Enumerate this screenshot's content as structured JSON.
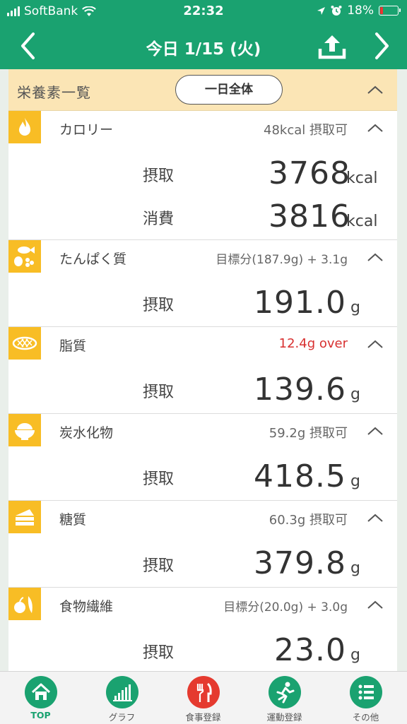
{
  "status_bar": {
    "carrier": "SoftBank",
    "time": "22:32",
    "battery": "18%",
    "battery_level": 0.18
  },
  "header": {
    "title": "今日 1/15 (火)"
  },
  "section": {
    "title": "栄養素一覧",
    "scope_button": "一日全体"
  },
  "nutrients": [
    {
      "name": "カロリー",
      "status": "48kcal 摂取可",
      "rows": [
        {
          "label": "摂取",
          "value": "3768",
          "unit": "kcal"
        },
        {
          "label": "消費",
          "value": "3816",
          "unit": "kcal"
        }
      ]
    },
    {
      "name": "たんぱく質",
      "status": "目標分(187.9g) + 3.1g",
      "rows": [
        {
          "label": "摂取",
          "value": "191.0",
          "unit": "g"
        }
      ]
    },
    {
      "name": "脂質",
      "status": "12.4g over",
      "rows": [
        {
          "label": "摂取",
          "value": "139.6",
          "unit": "g"
        }
      ]
    },
    {
      "name": "炭水化物",
      "status": "59.2g 摂取可",
      "rows": [
        {
          "label": "摂取",
          "value": "418.5",
          "unit": "g"
        }
      ]
    },
    {
      "name": "糖質",
      "status": "60.3g 摂取可",
      "rows": [
        {
          "label": "摂取",
          "value": "379.8",
          "unit": "g"
        }
      ]
    },
    {
      "name": "食物繊維",
      "status": "目標分(20.0g) + 3.0g",
      "rows": [
        {
          "label": "摂取",
          "value": "23.0",
          "unit": "g"
        }
      ]
    }
  ],
  "tabs": [
    {
      "label": "TOP",
      "icon": "home-icon"
    },
    {
      "label": "グラフ",
      "icon": "bar-chart-icon"
    },
    {
      "label": "食事登録",
      "icon": "fork-knife-icon"
    },
    {
      "label": "運動登録",
      "icon": "runner-icon"
    },
    {
      "label": "その他",
      "icon": "list-icon"
    }
  ],
  "colors": {
    "brand": "#1aa270",
    "section_bg": "#fbe5b5",
    "icon_bg": "#f8bd25",
    "over": "#d83030",
    "meal_tab": "#e53a2f"
  }
}
